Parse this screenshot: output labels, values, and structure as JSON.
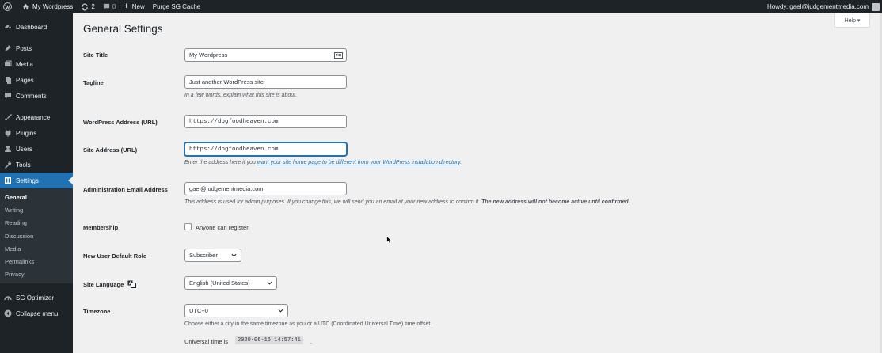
{
  "adminbar": {
    "site_name": "My Wordpress",
    "updates_count": "2",
    "comments_count": "0",
    "new_label": "New",
    "purge_label": "Purge SG Cache",
    "howdy": "Howdy, gael@judgementmedia.com"
  },
  "sidebar": {
    "items": [
      {
        "label": "Dashboard",
        "icon": "dashboard-icon"
      },
      {
        "label": "Posts",
        "icon": "pin-icon"
      },
      {
        "label": "Media",
        "icon": "media-icon"
      },
      {
        "label": "Pages",
        "icon": "pages-icon"
      },
      {
        "label": "Comments",
        "icon": "comments-icon"
      },
      {
        "label": "Appearance",
        "icon": "brush-icon"
      },
      {
        "label": "Plugins",
        "icon": "plugin-icon"
      },
      {
        "label": "Users",
        "icon": "users-icon"
      },
      {
        "label": "Tools",
        "icon": "wrench-icon"
      },
      {
        "label": "Settings",
        "icon": "settings-icon"
      }
    ],
    "submenu": [
      "General",
      "Writing",
      "Reading",
      "Discussion",
      "Media",
      "Permalinks",
      "Privacy"
    ],
    "sg_optimizer": "SG Optimizer",
    "collapse": "Collapse menu"
  },
  "help_label": "Help ▾",
  "page_title": "General Settings",
  "fields": {
    "site_title": {
      "label": "Site Title",
      "value": "My Wordpress"
    },
    "tagline": {
      "label": "Tagline",
      "value": "Just another WordPress site",
      "desc": "In a few words, explain what this site is about."
    },
    "wp_address": {
      "label": "WordPress Address (URL)",
      "value": "https://dogfoodheaven.com"
    },
    "site_address": {
      "label": "Site Address (URL)",
      "value": "https://dogfoodheaven.com",
      "desc_pre": "Enter the address here if you ",
      "desc_link": "want your site home page to be different from your WordPress installation directory",
      "desc_post": "."
    },
    "admin_email": {
      "label": "Administration Email Address",
      "value": "gael@judgementmedia.com",
      "desc_pre": "This address is used for admin purposes. If you change this, we will send you an email at your new address to confirm it. ",
      "desc_bold": "The new address will not become active until confirmed."
    },
    "membership": {
      "label": "Membership",
      "checkbox_label": "Anyone can register"
    },
    "default_role": {
      "label": "New User Default Role",
      "value": "Subscriber"
    },
    "site_language": {
      "label": "Site Language",
      "value": "English (United States)"
    },
    "timezone": {
      "label": "Timezone",
      "value": "UTC+0",
      "desc": "Choose either a city in the same timezone as you or a UTC (Coordinated Universal Time) time offset.",
      "universal_label": "Universal time is",
      "universal_value": "2020-06-16 14:57:41",
      "universal_post": "."
    }
  },
  "colors": {
    "accent": "#2271b1",
    "adminbar": "#1d2327",
    "background": "#f0f0f1"
  }
}
